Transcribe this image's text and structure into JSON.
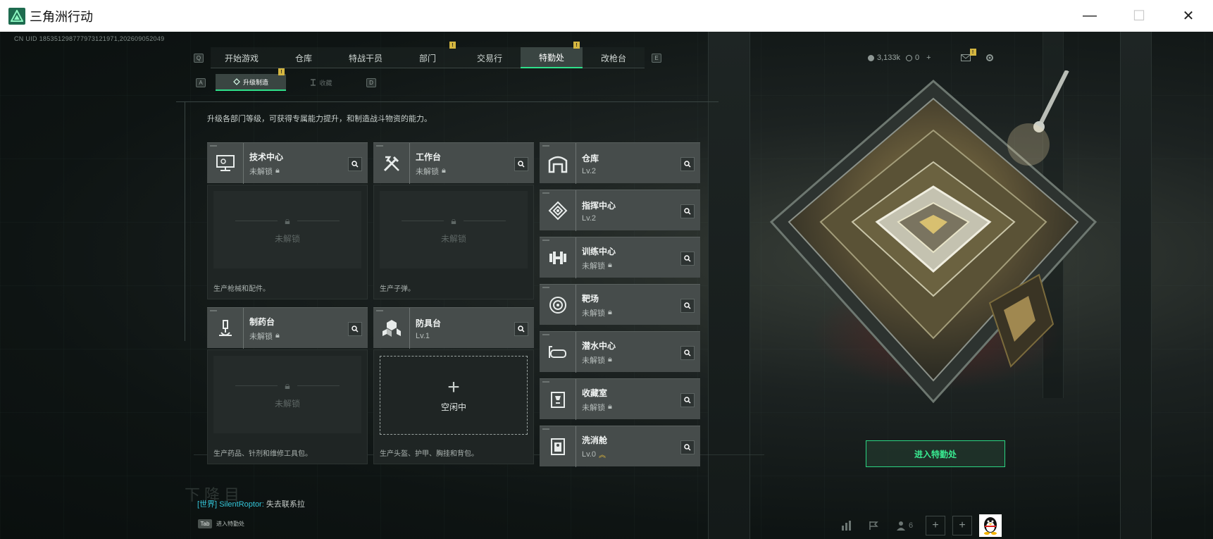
{
  "window": {
    "title": "三角洲行动",
    "minimize": "—",
    "maximize": "☐",
    "close": "✕"
  },
  "uid": "CN UID 185351298777973121971,202609052049",
  "nav": {
    "key_left": "Q",
    "key_right": "E",
    "tabs": [
      {
        "label": "开始游戏"
      },
      {
        "label": "仓库"
      },
      {
        "label": "特战干员"
      },
      {
        "label": "部门",
        "badge": "!"
      },
      {
        "label": "交易行"
      },
      {
        "label": "特勤处",
        "badge": "!"
      },
      {
        "label": "改枪台"
      }
    ],
    "active_tab": "特勤处"
  },
  "subnav": {
    "key_left": "A",
    "key_right": "D",
    "tabs": [
      {
        "label": "升级制造",
        "badge": "!"
      },
      {
        "label": "收藏"
      }
    ]
  },
  "hud": {
    "currency": "3,133k",
    "coins": "0",
    "plus": "+",
    "mail_badge": "!"
  },
  "description": "升级各部门等级，可获得专属能力提升，和制造战斗物资的能力。",
  "stations": [
    {
      "name": "技术中心",
      "status": "未解锁",
      "slot_text": "未解锁",
      "desc": "生产枪械和配件。"
    },
    {
      "name": "工作台",
      "status": "未解锁",
      "slot_text": "未解锁",
      "desc": "生产子弹。"
    },
    {
      "name": "制药台",
      "status": "未解锁",
      "slot_text": "未解锁",
      "desc": "生产药品、针剂和维修工具包。"
    },
    {
      "name": "防具台",
      "status": "Lv.1",
      "slot_text": "空闲中",
      "desc": "生产头盔、护甲、胸挂和背包。"
    }
  ],
  "facilities": [
    {
      "name": "仓库",
      "status": "Lv.2"
    },
    {
      "name": "指挥中心",
      "status": "Lv.2"
    },
    {
      "name": "训练中心",
      "status": "未解锁"
    },
    {
      "name": "靶场",
      "status": "未解锁"
    },
    {
      "name": "潜水中心",
      "status": "未解锁"
    },
    {
      "name": "收藏室",
      "status": "未解锁"
    },
    {
      "name": "洗消舱",
      "status": "Lv.0"
    }
  ],
  "enter_button": "进入特勤处",
  "chat": {
    "channel": "[世界]",
    "user": "SilentRoptor:",
    "message": " 失去联系拉"
  },
  "tab_hint": {
    "key": "Tab",
    "label": "进入特勤处"
  },
  "bottom": {
    "friends": "6",
    "plus": "+"
  },
  "faint_text": "下降目",
  "colors": {
    "accent": "#2fe08a",
    "badge": "#d4b640",
    "chat": "#34c6d9"
  }
}
